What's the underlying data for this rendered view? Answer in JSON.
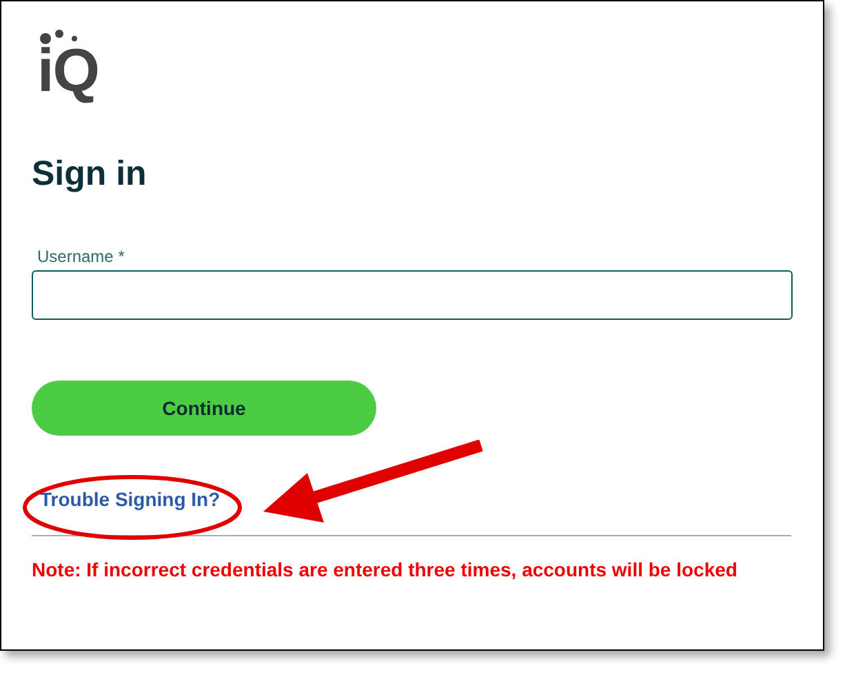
{
  "logo": {
    "text": "iQ"
  },
  "title": "Sign in",
  "username": {
    "label": "Username *"
  },
  "continue_button": "Continue",
  "trouble_link": "Trouble Signing In?",
  "note": "Note: If incorrect credentials are entered three times, accounts will be locked"
}
